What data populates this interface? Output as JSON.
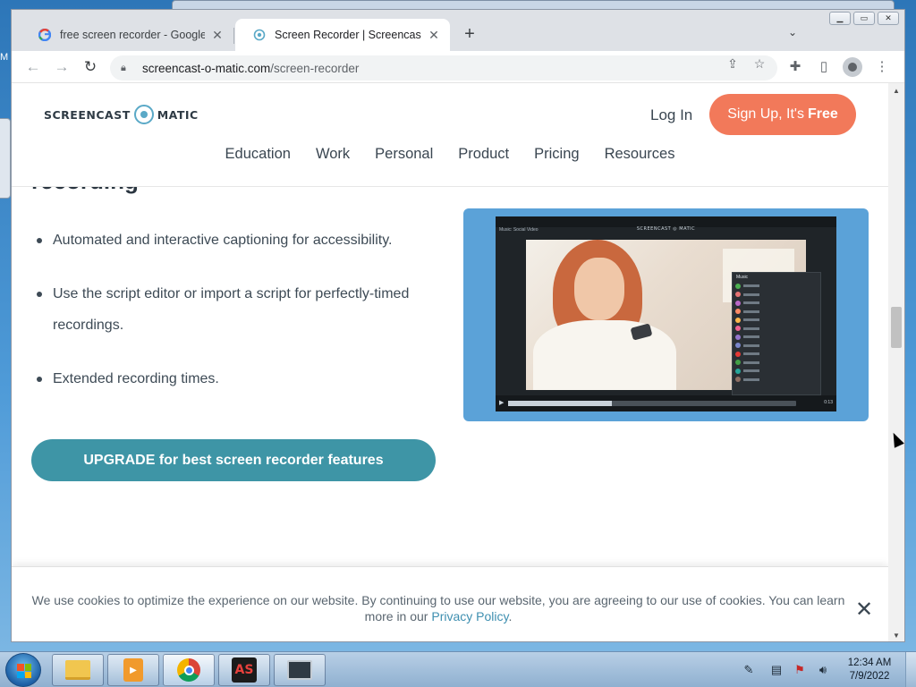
{
  "desktop": {
    "left_edge_text": "M"
  },
  "browser": {
    "tabs": [
      {
        "title": "free screen recorder - Google Se",
        "favicon": "google-icon",
        "active": false
      },
      {
        "title": "Screen Recorder | Screencast-O-M",
        "favicon": "screencast-o-matic-icon",
        "active": true
      }
    ],
    "new_tab_symbol": "+",
    "tab_search_symbol": "⌄",
    "address": {
      "domain": "screencast-o-matic.com",
      "path": "/screen-recorder"
    },
    "window_controls": [
      "minimize",
      "maximize",
      "close"
    ]
  },
  "site": {
    "logo": {
      "left": "SCREENCAST",
      "right": "MATIC"
    },
    "login_label": "Log In",
    "signup": {
      "label": "Sign Up, It's",
      "bold": "Free"
    },
    "nav": [
      "Education",
      "Work",
      "Personal",
      "Product",
      "Pricing",
      "Resources"
    ]
  },
  "content": {
    "heading_fragment": "recording",
    "features": [
      "Automated and interactive captioning for accessibility.",
      "Use the script editor or import a script for perfectly-timed recordings.",
      "Extended recording times."
    ],
    "upgrade_label": "UPGRADE for best screen recorder features",
    "preview": {
      "brand": "SCREENCAST ◎ MATIC",
      "file_label": "Music: Social Video",
      "panel_title": "Music",
      "time": "0:13",
      "progress": 0.36
    }
  },
  "cookie_banner": {
    "text": "We use cookies to optimize the experience on our website. By continuing to use our website, you are agreeing to our use of cookies. You can learn more in our",
    "link_text": "Privacy Policy",
    "suffix": "."
  },
  "taskbar": {
    "apps": [
      "explorer-icon",
      "media-player-icon",
      "chrome-icon",
      "as-app-icon",
      "monitor-app-icon"
    ],
    "as_label": "AS",
    "clock_time": "12:34 AM",
    "clock_date": "7/9/2022"
  },
  "colors": {
    "signup_bg": "#f2795a",
    "upgrade_bg": "#3e95a6",
    "preview_bg": "#5ba2d8",
    "link": "#3e8fb0"
  }
}
